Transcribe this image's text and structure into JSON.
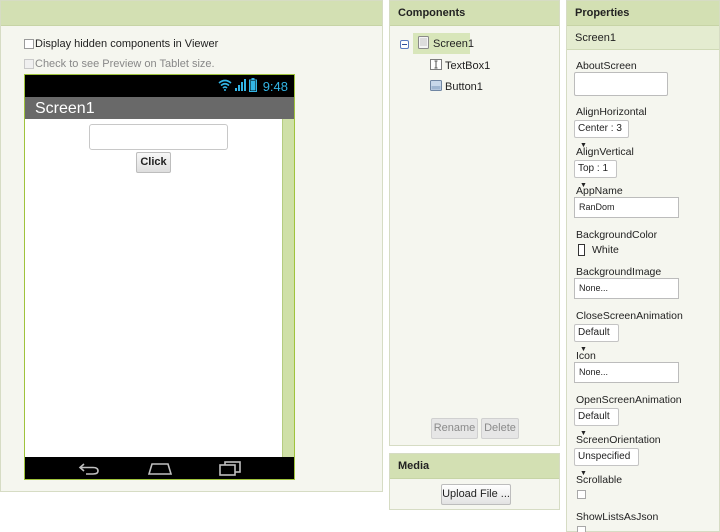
{
  "viewer": {
    "hidden_components_label": "Display hidden components in Viewer",
    "tablet_preview_label": "Check to see Preview on Tablet size.",
    "phone": {
      "time": "9:48",
      "screen_title": "Screen1",
      "button_label": "Click"
    }
  },
  "components": {
    "header": "Components",
    "tree": [
      {
        "label": "Screen1",
        "icon": "screen-icon"
      },
      {
        "label": "TextBox1",
        "icon": "textbox-icon"
      },
      {
        "label": "Button1",
        "icon": "button-icon"
      }
    ],
    "rename_label": "Rename",
    "delete_label": "Delete"
  },
  "media": {
    "header": "Media",
    "upload_label": "Upload File ..."
  },
  "properties": {
    "header": "Properties",
    "component": "Screen1",
    "about_screen": {
      "label": "AboutScreen",
      "value": ""
    },
    "align_horizontal": {
      "label": "AlignHorizontal",
      "value": "Center : 3"
    },
    "align_vertical": {
      "label": "AlignVertical",
      "value": "Top : 1"
    },
    "app_name": {
      "label": "AppName",
      "value": "RanDom"
    },
    "background_color": {
      "label": "BackgroundColor",
      "value": "White"
    },
    "background_image": {
      "label": "BackgroundImage",
      "value": "None..."
    },
    "close_screen_animation": {
      "label": "CloseScreenAnimation",
      "value": "Default"
    },
    "icon": {
      "label": "Icon",
      "value": "None..."
    },
    "open_screen_animation": {
      "label": "OpenScreenAnimation",
      "value": "Default"
    },
    "screen_orientation": {
      "label": "ScreenOrientation",
      "value": "Unspecified"
    },
    "scrollable": {
      "label": "Scrollable",
      "checked": false
    },
    "show_lists_as_json": {
      "label": "ShowListsAsJson",
      "checked": false
    }
  },
  "colors": {
    "header_green": "#d3e0b3",
    "panel_bg": "#f5f6ef",
    "phone_border": "#9fc33c",
    "status_blue": "#33b5e5"
  }
}
